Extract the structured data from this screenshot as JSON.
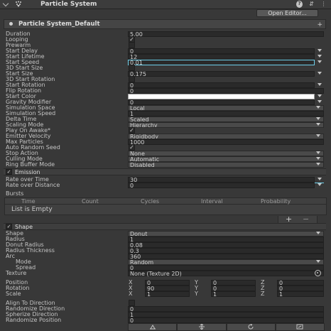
{
  "header": {
    "title": "Particle System",
    "menu_icon": "kebab-menu-icon"
  },
  "open_editor": "Open Editor...",
  "main_module": {
    "title": "Particle System_Default",
    "rows": [
      {
        "label": "Duration",
        "value": "5.00"
      },
      {
        "label": "Looping",
        "checked": true
      },
      {
        "label": "Prewarm",
        "checked": false
      },
      {
        "label": "Start Delay",
        "value": "0"
      },
      {
        "label": "Start Lifetime",
        "value": "12"
      },
      {
        "label": "Start Speed",
        "value": "0.01"
      },
      {
        "label": "3D Start Size",
        "checked": false
      },
      {
        "label": "Start Size",
        "value": "0.175"
      },
      {
        "label": "3D Start Rotation",
        "checked": false
      },
      {
        "label": "Start Rotation",
        "value": "0"
      },
      {
        "label": "Flip Rotation",
        "value": "0"
      },
      {
        "label": "Start Color",
        "color": "#ffffff"
      },
      {
        "label": "Gravity Modifier",
        "value": "0"
      },
      {
        "label": "Simulation Space",
        "value": "Local"
      },
      {
        "label": "Simulation Speed",
        "value": "1"
      },
      {
        "label": "Delta Time",
        "value": "Scaled"
      },
      {
        "label": "Scaling Mode",
        "value": "Hierarchy"
      },
      {
        "label": "Play On Awake*",
        "checked": true
      },
      {
        "label": "Emitter Velocity",
        "value": "Rigidbody"
      },
      {
        "label": "Max Particles",
        "value": "1000"
      },
      {
        "label": "Auto Random Seed",
        "checked": true
      },
      {
        "label": "Stop Action",
        "value": "None"
      },
      {
        "label": "Culling Mode",
        "value": "Automatic"
      },
      {
        "label": "Ring Buffer Mode",
        "value": "Disabled"
      }
    ]
  },
  "emission": {
    "title": "Emission",
    "enabled": true,
    "rate_over_time_label": "Rate over Time",
    "rate_over_time": "30",
    "rate_over_distance_label": "Rate over Distance",
    "rate_over_distance": "0",
    "bursts_label": "Bursts",
    "bursts_columns": [
      "Time",
      "Count",
      "Cycles",
      "Interval",
      "Probability"
    ],
    "bursts_empty": "List is Empty",
    "add": "+",
    "remove": "−"
  },
  "shape": {
    "title": "Shape",
    "enabled": true,
    "shape_label": "Shape",
    "shape_value": "Donut",
    "radius_label": "Radius",
    "radius_value": "1",
    "donut_radius_label": "Donut Radius",
    "donut_radius_value": "0.08",
    "radius_thickness_label": "Radius Thickness",
    "radius_thickness_value": "0.3",
    "arc_label": "Arc",
    "arc_value": "360",
    "mode_label": "Mode",
    "mode_value": "Random",
    "spread_label": "Spread",
    "spread_value": "0",
    "texture_label": "Texture",
    "texture_value": "None (Texture 2D)",
    "position_label": "Position",
    "position": {
      "x": "0",
      "y": "0",
      "z": "0"
    },
    "rotation_label": "Rotation",
    "rotation": {
      "x": "90",
      "y": "0",
      "z": "0"
    },
    "scale_label": "Scale",
    "scale": {
      "x": "1",
      "y": "1",
      "z": "1"
    },
    "axis_x": "X",
    "axis_y": "Y",
    "axis_z": "Z",
    "align_label": "Align To Direction",
    "align_checked": false,
    "rand_dir_label": "Randomize Direction",
    "rand_dir_value": "0",
    "sph_dir_label": "Spherize Direction",
    "sph_dir_value": "1",
    "rand_pos_label": "Randomize Position",
    "rand_pos_value": "0"
  },
  "toolbar": [
    "move-tool-icon",
    "transform-tool-icon",
    "rotate-tool-icon",
    "scale-tool-icon"
  ],
  "colors": {
    "accent": "#6fd0ea",
    "panel": "#383838",
    "field": "#2a2a2a"
  }
}
